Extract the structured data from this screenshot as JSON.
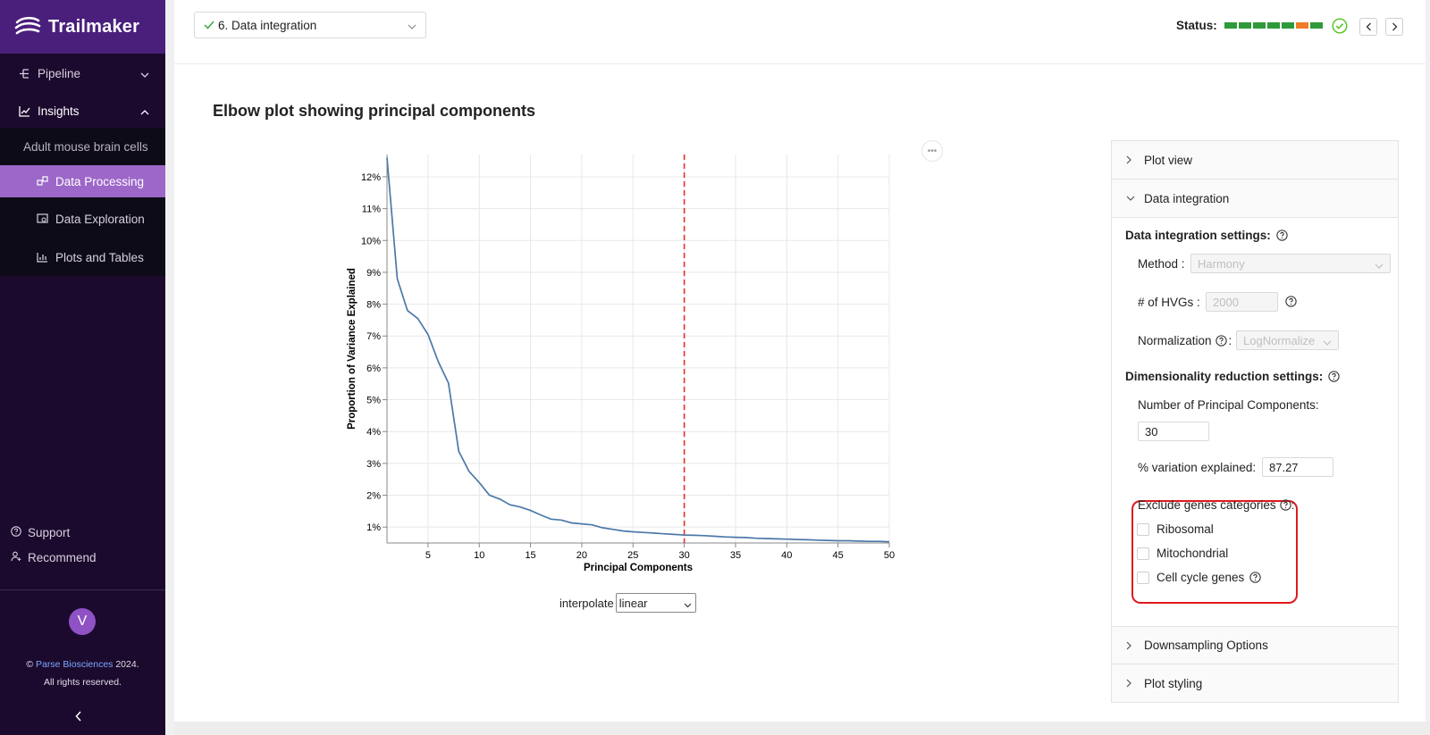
{
  "app": {
    "brand": "Trailmaker"
  },
  "sidebar": {
    "pipeline_label": "Pipeline",
    "insights_label": "Insights",
    "experiment_name": "Adult mouse brain cells",
    "items": [
      {
        "label": "Data Processing",
        "selected": true
      },
      {
        "label": "Data Exploration",
        "selected": false
      },
      {
        "label": "Plots and Tables",
        "selected": false
      }
    ],
    "support_label": "Support",
    "recommend_label": "Recommend",
    "avatar_initial": "V",
    "copyright_prefix": "©",
    "copyright_org": "Parse Biosciences",
    "copyright_year": "2024.",
    "copyright_rights": "All rights reserved."
  },
  "header": {
    "step_selected": "6. Data integration",
    "status_label": "Status:",
    "status_steps": [
      "complete",
      "complete",
      "complete",
      "complete",
      "complete",
      "warning",
      "complete"
    ],
    "status_colors": {
      "complete": "#2e9a3a",
      "warning": "#f07b28",
      "ok_icon": "#52c41a"
    }
  },
  "plot": {
    "title": "Elbow plot showing principal components",
    "interpolate_label": "interpolate",
    "interpolate_value": "linear"
  },
  "chart_data": {
    "type": "line",
    "xlabel": "Principal Components",
    "ylabel": "Proportion of Variance Explained",
    "xlim": [
      1,
      50
    ],
    "ylim": [
      0.005,
      0.127
    ],
    "x_ticks": [
      5,
      10,
      15,
      20,
      25,
      30,
      35,
      40,
      45,
      50
    ],
    "y_ticks": [
      0.01,
      0.02,
      0.03,
      0.04,
      0.05,
      0.06,
      0.07,
      0.08,
      0.09,
      0.1,
      0.11,
      0.12
    ],
    "y_tick_labels": [
      "1%",
      "2%",
      "3%",
      "4%",
      "5%",
      "6%",
      "7%",
      "8%",
      "9%",
      "10%",
      "11%",
      "12%"
    ],
    "grid": true,
    "threshold_x": 30,
    "threshold_color": "#e4302b",
    "line_color": "#4c78a8",
    "x": [
      1,
      2,
      3,
      4,
      5,
      6,
      7,
      8,
      9,
      10,
      11,
      12,
      13,
      14,
      15,
      16,
      17,
      18,
      19,
      20,
      21,
      22,
      23,
      24,
      25,
      26,
      27,
      28,
      29,
      30,
      31,
      32,
      33,
      34,
      35,
      36,
      37,
      38,
      39,
      40,
      41,
      42,
      43,
      44,
      45,
      46,
      47,
      48,
      49,
      50
    ],
    "y": [
      0.126,
      0.088,
      0.078,
      0.0755,
      0.0705,
      0.062,
      0.0552,
      0.0338,
      0.0275,
      0.024,
      0.02,
      0.0188,
      0.017,
      0.0163,
      0.0152,
      0.0138,
      0.0125,
      0.0122,
      0.0113,
      0.011,
      0.0107,
      0.0098,
      0.0093,
      0.0088,
      0.0085,
      0.0083,
      0.0081,
      0.0079,
      0.0077,
      0.0075,
      0.0074,
      0.0073,
      0.0071,
      0.0069,
      0.0068,
      0.0067,
      0.0065,
      0.0064,
      0.0063,
      0.0062,
      0.0061,
      0.006,
      0.0059,
      0.0058,
      0.0057,
      0.0057,
      0.0056,
      0.0055,
      0.0055,
      0.0054
    ]
  },
  "panel": {
    "plot_view_label": "Plot view",
    "data_integration_label": "Data integration",
    "settings_title": "Data integration settings:",
    "method_label": "Method :",
    "method_value": "Harmony",
    "hvgs_label": "# of HVGs :",
    "hvgs_value": "2000",
    "normalization_label": "Normalization",
    "normalization_suffix": ":",
    "normalization_value": "LogNormalize",
    "dimred_title": "Dimensionality reduction settings:",
    "num_pcs_label": "Number of Principal Components:",
    "num_pcs_value": "30",
    "variation_label": "% variation explained:",
    "variation_value": "87.27",
    "exclude_title": "Exclude genes categories",
    "exclude_suffix": ":",
    "exclude_options": [
      {
        "label": "Ribosomal",
        "checked": false
      },
      {
        "label": "Mitochondrial",
        "checked": false
      },
      {
        "label": "Cell cycle genes",
        "checked": false
      }
    ],
    "downsampling_label": "Downsampling Options",
    "plot_styling_label": "Plot styling"
  }
}
